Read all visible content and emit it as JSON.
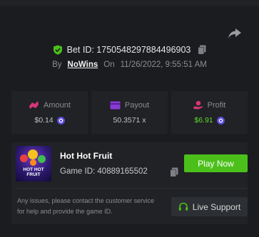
{
  "bet": {
    "id_text": "Bet ID: 1750548297884496903",
    "by_label": "By",
    "username": "NoWins",
    "on_label": "On",
    "date": "11/26/2022, 9:55:51 AM"
  },
  "stats": [
    {
      "label": "Amount",
      "value": "$0.14",
      "icon": "coins-icon",
      "currency_icon": "crypto-coin-icon"
    },
    {
      "label": "Payout",
      "value": "50.3571 x",
      "icon": "payout-card-icon"
    },
    {
      "label": "Profit",
      "value": "$6.91",
      "icon": "profit-hand-icon",
      "currency_icon": "crypto-coin-icon",
      "value_color": "#5ddb2c"
    }
  ],
  "game": {
    "title": "Hot Hot Fruit",
    "id_text": "Game ID: 40889165502",
    "play_label": "Play Now",
    "thumbnail_text": "HOT HOT FRUIT"
  },
  "support": {
    "text": "Any issues, please contact the customer service for help and provide the game ID.",
    "button_label": "Live Support"
  },
  "colors": {
    "background": "#1a1c1f",
    "card": "#202225",
    "accent_green": "#4cc01a",
    "profit_green": "#5ddb2c",
    "payout_purple": "#8a3ad6",
    "amount_pink": "#d8357a"
  }
}
